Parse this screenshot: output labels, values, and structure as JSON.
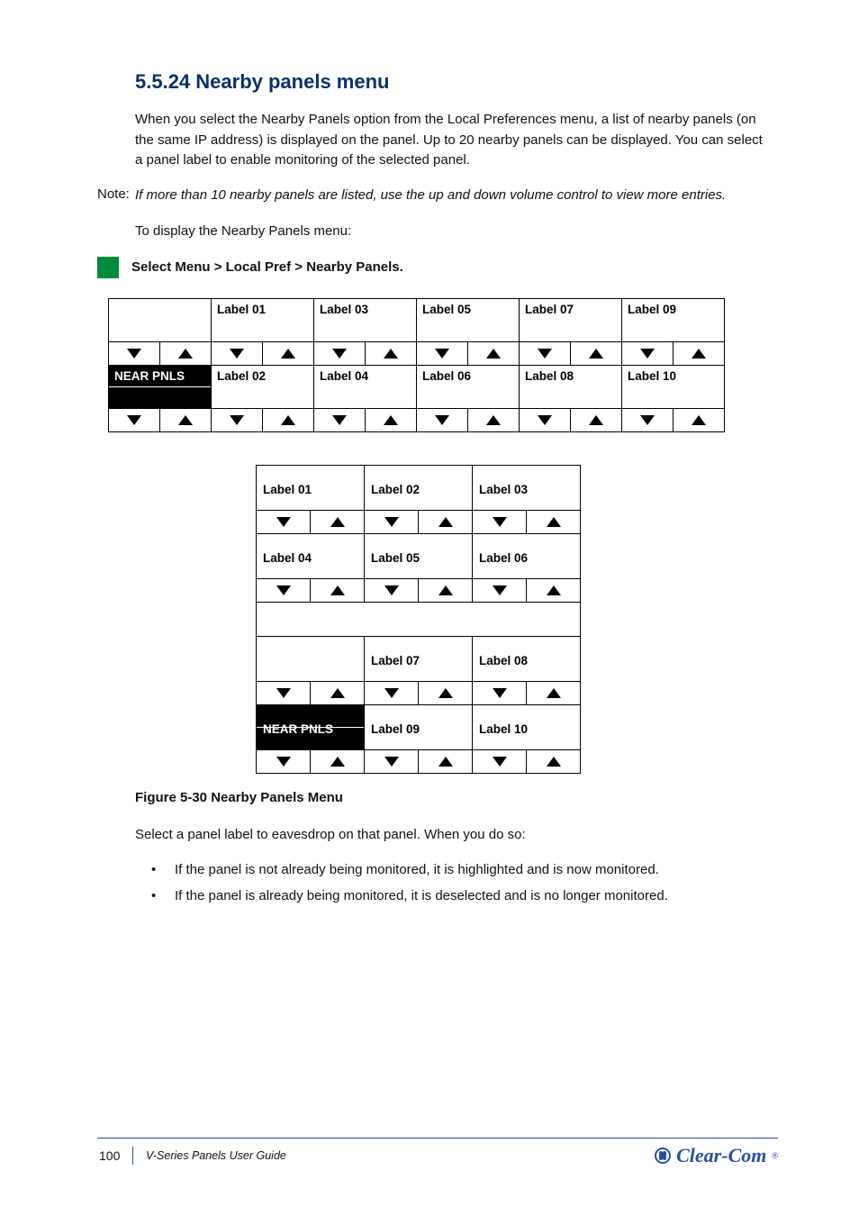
{
  "heading": "5.5.24 Nearby panels menu",
  "para1": "When you select the Nearby Panels option from the Local Preferences menu, a list of nearby panels (on the same IP address) is displayed on the panel. Up to 20 nearby panels can be displayed. You can select a panel label to enable monitoring of the selected panel.",
  "noteLabel": "Note:",
  "noteText": "If more than 10 nearby panels are listed, use the up and down volume control to view more entries.",
  "step": "To display the Nearby Panels menu:",
  "bullet1": "Select Menu > Local Pref > Nearby Panels.",
  "near": "NEAR PNLS",
  "row1": [
    "",
    "Label 01",
    "Label 03",
    "Label 05",
    "Label 07",
    "Label 09"
  ],
  "row2": [
    "NEAR PNLS",
    "Label 02",
    "Label 04",
    "Label 06",
    "Label 08",
    "Label 10"
  ],
  "srowA": [
    "Label 01",
    "Label 02",
    "Label 03"
  ],
  "srowB": [
    "Label 04",
    "Label 05",
    "Label 06"
  ],
  "srowC": [
    "",
    "Label 07",
    "Label 08"
  ],
  "srowD": [
    "NEAR PNLS",
    "Label 09",
    "Label 10"
  ],
  "figcap": "Figure 5-30 Nearby Panels Menu",
  "endpara": "Select a panel label to eavesdrop on that panel. When you do so:",
  "endb1": "If the panel is not already being monitored, it is highlighted and is now monitored.",
  "endb2": "If the panel is already being monitored, it is deselected and is no longer monitored.",
  "footer": {
    "page": "100",
    "title": "V-Series Panels User Guide",
    "brand": "Clear-Com"
  }
}
